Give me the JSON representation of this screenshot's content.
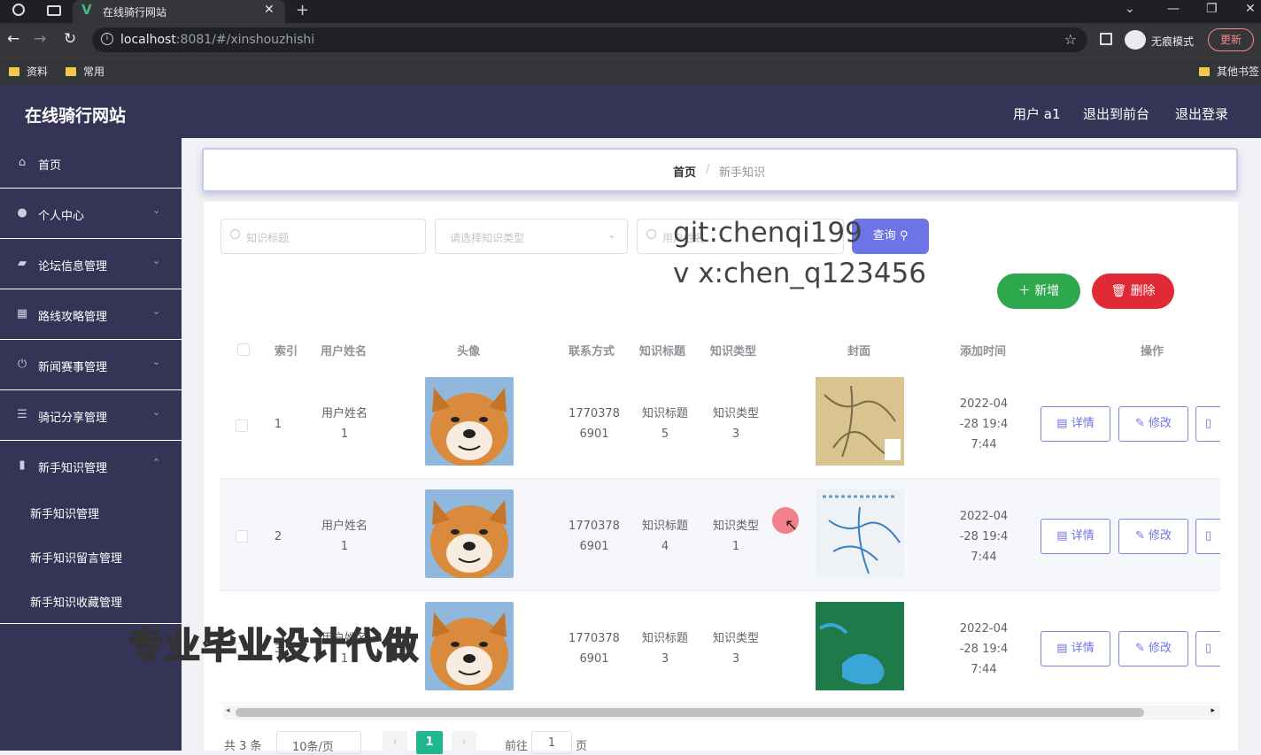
{
  "browser": {
    "tab_title": "在线骑行网站",
    "url_host": "localhost",
    "url_rest": ":8081/#/xinshouzhishi",
    "incognito_label": "无痕模式",
    "update_label": "更新",
    "bookmarks": [
      "资料",
      "常用"
    ],
    "other_bookmarks": "其他书签"
  },
  "header": {
    "logo": "在线骑行网站",
    "user": "用户 a1",
    "front": "退出到前台",
    "logout": "退出登录"
  },
  "sidebar": {
    "items": [
      {
        "label": "首页",
        "icon": "home-icon"
      },
      {
        "label": "个人中心",
        "icon": "user-icon"
      },
      {
        "label": "论坛信息管理",
        "icon": "forum-icon"
      },
      {
        "label": "路线攻略管理",
        "icon": "grid-icon"
      },
      {
        "label": "新闻赛事管理",
        "icon": "power-icon"
      },
      {
        "label": "骑记分享管理",
        "icon": "sliders-icon"
      },
      {
        "label": "新手知识管理",
        "icon": "chart-icon"
      }
    ],
    "sub_items": [
      "新手知识管理",
      "新手知识留言管理",
      "新手知识收藏管理"
    ]
  },
  "breadcrumb": {
    "home": "首页",
    "sep": "/",
    "current": "新手知识"
  },
  "search": {
    "title_placeholder": "知识标题",
    "type_placeholder": "请选择知识类型",
    "third_placeholder": "用户姓名",
    "query_label": "查询"
  },
  "actions": {
    "add": "新增",
    "delete": "删除"
  },
  "watermark": {
    "line1": "git:chenqi199",
    "line2": "v x:chen_q123456",
    "line3": "专业毕业设计代做"
  },
  "table": {
    "headers": [
      "索引",
      "用户姓名",
      "头像",
      "联系方式",
      "知识标题",
      "知识类型",
      "封面",
      "添加时间",
      "操作"
    ],
    "rows": [
      {
        "index": "1",
        "name1": "用户姓名",
        "name2": "1",
        "phone1": "1770378",
        "phone2": "6901",
        "title1": "知识标题",
        "title2": "5",
        "type1": "知识类型",
        "type2": "3",
        "time1": "2022-04",
        "time2": "-28 19:4",
        "time3": "7:44"
      },
      {
        "index": "2",
        "name1": "用户姓名",
        "name2": "1",
        "phone1": "1770378",
        "phone2": "6901",
        "title1": "知识标题",
        "title2": "4",
        "type1": "知识类型",
        "type2": "1",
        "time1": "2022-04",
        "time2": "-28 19:4",
        "time3": "7:44"
      },
      {
        "index": "3",
        "name1": "用户姓名",
        "name2": "1",
        "phone1": "1770378",
        "phone2": "6901",
        "title1": "知识标题",
        "title2": "3",
        "type1": "知识类型",
        "type2": "3",
        "time1": "2022-04",
        "time2": "-28 19:4",
        "time3": "7:44"
      }
    ],
    "detail_label": "详情",
    "edit_label": "修改"
  },
  "pagination": {
    "total": "共 3 条",
    "page_size": "10条/页",
    "current": "1",
    "goto_prefix": "前往",
    "goto_value": "1",
    "goto_suffix": "页"
  },
  "colors": {
    "sidebar": "#353456",
    "primary": "#6c74e6",
    "success": "#2ea84c",
    "danger": "#e02a36",
    "pager_active": "#1fb58f"
  }
}
